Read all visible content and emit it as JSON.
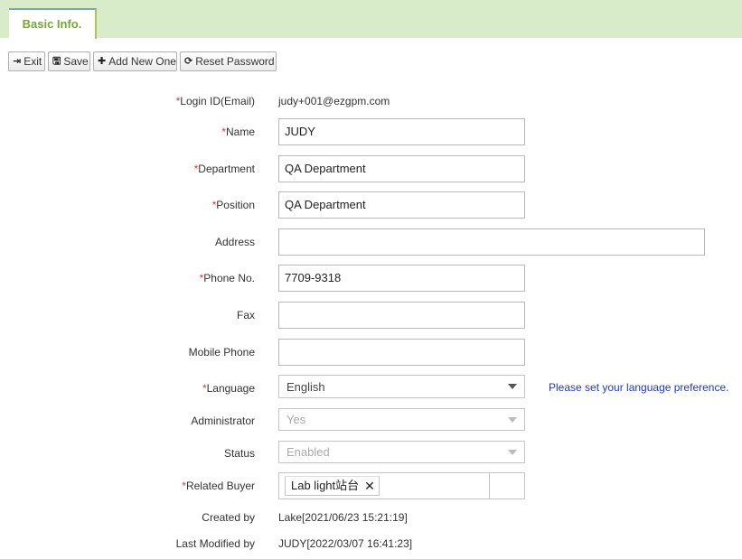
{
  "tab": {
    "label": "Basic Info."
  },
  "toolbar": {
    "exit_label": "Exit",
    "save_label": "Save",
    "add_label": "Add New One",
    "reset_label": "Reset Password"
  },
  "form": {
    "login": {
      "label": "Login ID(Email)",
      "value": "judy+001@ezgpm.com"
    },
    "name": {
      "label": "Name",
      "value": "JUDY"
    },
    "department": {
      "label": "Department",
      "value": "QA Department"
    },
    "position": {
      "label": "Position",
      "value": "QA Department"
    },
    "address": {
      "label": "Address",
      "value": ""
    },
    "phone": {
      "label": "Phone No.",
      "value": "7709-9318"
    },
    "fax": {
      "label": "Fax",
      "value": ""
    },
    "mobile": {
      "label": "Mobile Phone",
      "value": ""
    },
    "language": {
      "label": "Language",
      "value": "English",
      "hint": "Please set your language preference."
    },
    "administrator": {
      "label": "Administrator",
      "value": "Yes"
    },
    "status": {
      "label": "Status",
      "value": "Enabled"
    },
    "buyer": {
      "label": "Related Buyer",
      "tag": "Lab light站台",
      "remove": "✕"
    },
    "created": {
      "label": "Created by",
      "value": "Lake[2021/06/23 15:21:19]"
    },
    "modified": {
      "label": "Last Modified by",
      "value": "JUDY[2022/03/07 16:41:23]"
    }
  },
  "required_mark": "*",
  "colors": {
    "tab_bar": "#d9ecc9",
    "tab_text": "#77a53a",
    "required": "#d9363e",
    "hint": "#2137c7"
  }
}
